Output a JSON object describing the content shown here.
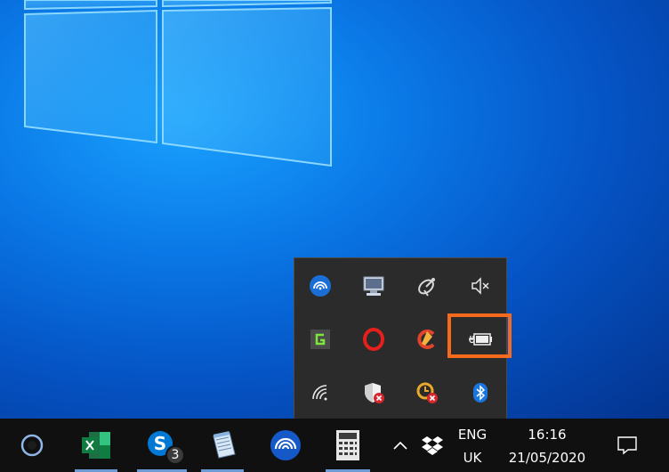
{
  "desktop": {
    "background_color": "#0a78e6"
  },
  "tray_overflow": {
    "rows": [
      [
        {
          "name": "connect-icon"
        },
        {
          "name": "display-icon"
        },
        {
          "name": "satellite-icon"
        },
        {
          "name": "volume-muted-icon"
        }
      ],
      [
        {
          "name": "greenshot-icon"
        },
        {
          "name": "opera-icon"
        },
        {
          "name": "ccleaner-icon"
        },
        {
          "name": "battery-power-icon"
        }
      ],
      [
        {
          "name": "wifi-icon"
        },
        {
          "name": "windows-security-icon"
        },
        {
          "name": "update-error-icon"
        },
        {
          "name": "bluetooth-icon"
        }
      ]
    ],
    "highlight_color": "#f56a1c"
  },
  "taskbar": {
    "apps": [
      {
        "name": "cortana-icon"
      },
      {
        "name": "excel-icon"
      },
      {
        "name": "skype-icon",
        "badge": "3"
      },
      {
        "name": "notepad-icon"
      },
      {
        "name": "connect-app-icon"
      },
      {
        "name": "calculator-icon"
      }
    ],
    "language": {
      "top": "ENG",
      "bottom": "UK"
    },
    "clock": {
      "time": "16:16",
      "date": "21/05/2020"
    }
  }
}
